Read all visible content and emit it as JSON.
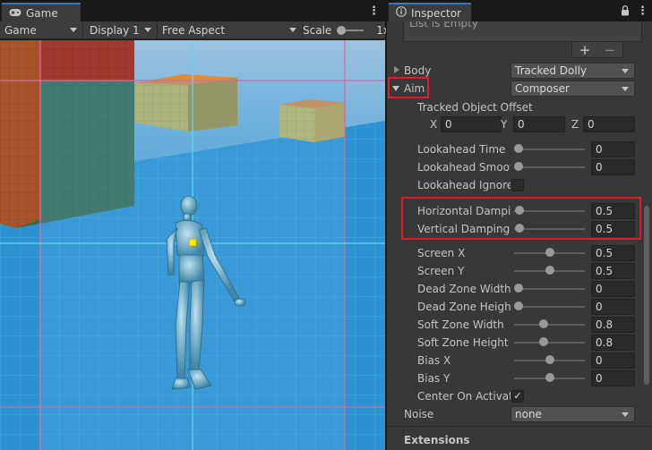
{
  "game": {
    "tab_label": "Game",
    "toolbar": {
      "mode": "Game",
      "display": "Display 1",
      "aspect": "Free Aspect",
      "scale_label": "Scale",
      "scale_value": "1x"
    }
  },
  "inspector": {
    "tab_label": "Inspector",
    "list_empty_text": "List is Empty",
    "plus_label": "+",
    "minus_label": "−",
    "body": {
      "label": "Body",
      "value": "Tracked Dolly"
    },
    "aim": {
      "label": "Aim",
      "value": "Composer"
    },
    "tracked_object_offset": {
      "label": "Tracked Object Offset",
      "x_label": "X",
      "x": "0",
      "y_label": "Y",
      "y": "0",
      "z_label": "Z",
      "z": "0"
    },
    "sliders": [
      {
        "label": "Lookahead Time",
        "value": "0",
        "fraction": 0.0
      },
      {
        "label": "Lookahead Smoothing",
        "value": "0",
        "fraction": 0.0
      }
    ],
    "lookahead_ignore": {
      "label": "Lookahead Ignore Y"
    },
    "damping": [
      {
        "label": "Horizontal Damping",
        "value": "0.5",
        "fraction": 0.02
      },
      {
        "label": "Vertical Damping",
        "value": "0.5",
        "fraction": 0.02
      }
    ],
    "screen_sliders": [
      {
        "label": "Screen X",
        "value": "0.5",
        "fraction": 0.5
      },
      {
        "label": "Screen Y",
        "value": "0.5",
        "fraction": 0.5
      },
      {
        "label": "Dead Zone Width",
        "value": "0",
        "fraction": 0.0
      },
      {
        "label": "Dead Zone Height",
        "value": "0",
        "fraction": 0.0
      },
      {
        "label": "Soft Zone Width",
        "value": "0.8",
        "fraction": 0.4
      },
      {
        "label": "Soft Zone Height",
        "value": "0.8",
        "fraction": 0.4
      },
      {
        "label": "Bias X",
        "value": "0",
        "fraction": 0.5
      },
      {
        "label": "Bias Y",
        "value": "0",
        "fraction": 0.5
      }
    ],
    "center_on_activate": {
      "label": "Center On Activate",
      "checked": "✓"
    },
    "noise": {
      "label": "Noise",
      "value": "none"
    },
    "extensions_label": "Extensions"
  }
}
